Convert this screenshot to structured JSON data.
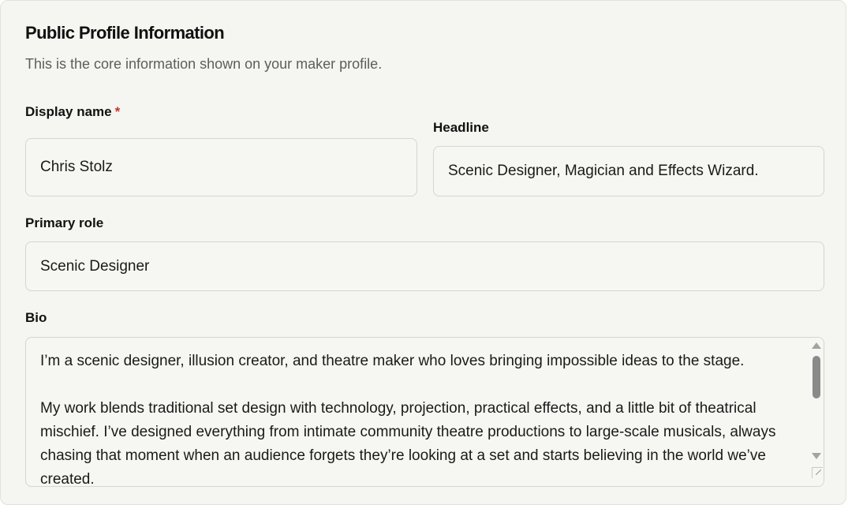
{
  "section": {
    "title": "Public Profile Information",
    "subtitle": "This is the core information shown on your maker profile."
  },
  "fields": {
    "display_name": {
      "label": "Display name",
      "required_marker": "*",
      "value": "Chris Stolz"
    },
    "headline": {
      "label": "Headline",
      "value": "Scenic Designer, Magician and Effects Wizard."
    },
    "primary_role": {
      "label": "Primary role",
      "value": "Scenic Designer"
    },
    "bio": {
      "label": "Bio",
      "paragraphs": [
        "I’m a scenic designer, illusion creator, and theatre maker who loves bringing impossible ideas to the stage.",
        "My work blends traditional set design with technology, projection, practical effects, and a little bit of theatrical mischief. I’ve designed everything from intimate community theatre productions to large-scale musicals, always chasing that moment when an audience forgets they’re looking at a set and starts believing in the world we’ve created."
      ]
    }
  },
  "icons": {
    "scroll_up": "triangle-up-icon",
    "scroll_down": "triangle-down-icon",
    "resize": "resize-grip-icon"
  },
  "colors": {
    "background": "#f5f5f1",
    "required": "#c0392b",
    "border": "#d6d6d0",
    "text": "#111111",
    "muted_text": "#5d5d5d"
  }
}
